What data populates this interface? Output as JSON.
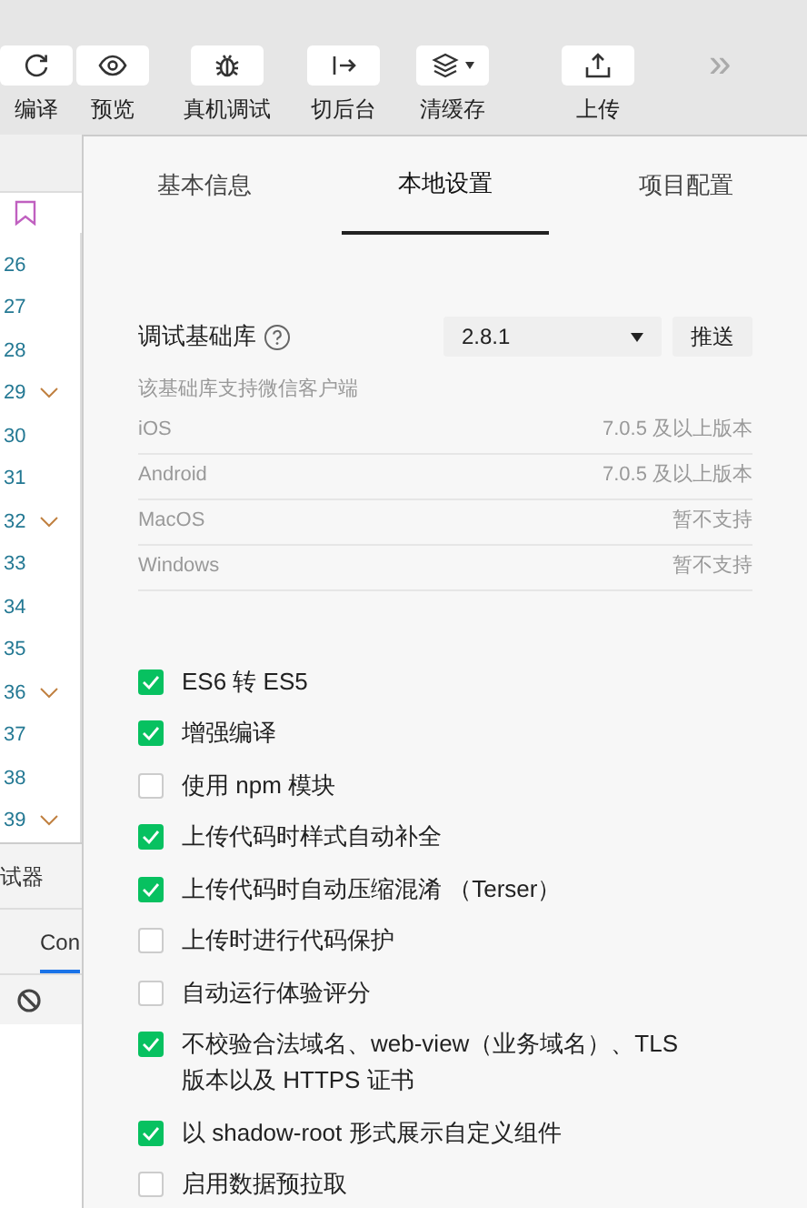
{
  "toolbar": {
    "buttons": [
      {
        "kind": "refresh",
        "label": "编译"
      },
      {
        "kind": "eye",
        "label": "预览"
      },
      {
        "kind": "bug",
        "label": "真机调试"
      },
      {
        "kind": "switch",
        "label": "切后台"
      },
      {
        "kind": "layers",
        "label": "清缓存"
      },
      {
        "kind": "upload",
        "label": "上传"
      }
    ],
    "more": "»"
  },
  "editor": {
    "lines": [
      {
        "number": "26",
        "folded": false
      },
      {
        "number": "27",
        "folded": false
      },
      {
        "number": "28",
        "folded": false
      },
      {
        "number": "29",
        "folded": true
      },
      {
        "number": "30",
        "folded": false
      },
      {
        "number": "31",
        "folded": false
      },
      {
        "number": "32",
        "folded": true
      },
      {
        "number": "33",
        "folded": false
      },
      {
        "number": "34",
        "folded": false
      },
      {
        "number": "35",
        "folded": false
      },
      {
        "number": "36",
        "folded": true
      },
      {
        "number": "37",
        "folded": false
      },
      {
        "number": "38",
        "folded": false
      },
      {
        "number": "39",
        "folded": true
      }
    ]
  },
  "debug_panel": {
    "tab": "试器",
    "console_tab": "Con"
  },
  "settings": {
    "tabs": [
      {
        "label": "基本信息",
        "selected": false
      },
      {
        "label": "本地设置",
        "selected": true
      },
      {
        "label": "项目配置",
        "selected": false
      }
    ],
    "library": {
      "label": "调试基础库",
      "version": "2.8.1",
      "push_button": "推送",
      "note": "该基础库支持微信客户端",
      "clients": [
        {
          "platform": "iOS",
          "support": "7.0.5 及以上版本"
        },
        {
          "platform": "Android",
          "support": "7.0.5 及以上版本"
        },
        {
          "platform": "MacOS",
          "support": "暂不支持"
        },
        {
          "platform": "Windows",
          "support": "暂不支持"
        }
      ]
    },
    "options": [
      {
        "label": "ES6 转 ES5",
        "checked": true
      },
      {
        "label": "增强编译",
        "checked": true
      },
      {
        "label": "使用 npm 模块",
        "checked": false
      },
      {
        "label": "上传代码时样式自动补全",
        "checked": true
      },
      {
        "label": "上传代码时自动压缩混淆 （Terser）",
        "checked": true
      },
      {
        "label": "上传时进行代码保护",
        "checked": false
      },
      {
        "label": "自动运行体验评分",
        "checked": false
      },
      {
        "label": "不校验合法域名、web-view（业务域名）、TLS 版本以及 HTTPS 证书",
        "checked": true
      },
      {
        "label": "以 shadow-root 形式展示自定义组件",
        "checked": true
      },
      {
        "label": "启用数据预拉取",
        "checked": false
      }
    ]
  }
}
